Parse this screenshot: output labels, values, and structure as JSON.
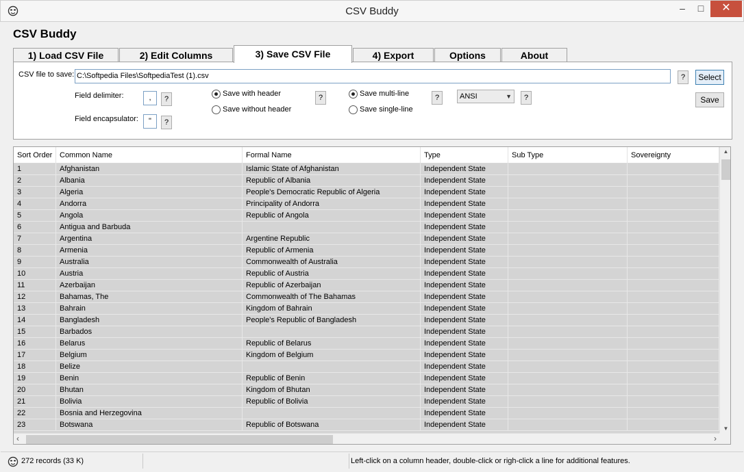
{
  "window": {
    "title": "CSV Buddy"
  },
  "app": {
    "heading": "CSV Buddy"
  },
  "tabs": [
    {
      "label": "1) Load CSV File"
    },
    {
      "label": "2) Edit Columns"
    },
    {
      "label": "3) Save CSV File"
    },
    {
      "label": "4) Export"
    },
    {
      "label": "Options"
    },
    {
      "label": "About"
    }
  ],
  "save": {
    "file_label": "CSV file to save:",
    "file_value": "C:\\Softpedia Files\\SoftpediaTest (1).csv",
    "help": "?",
    "select_label": "Select",
    "save_label": "Save",
    "delimiter_label": "Field delimiter:",
    "delimiter_value": ",",
    "encapsulator_label": "Field encapsulator:",
    "encapsulator_value": "\"",
    "header_with": "Save with header",
    "header_without": "Save without header",
    "multi_line": "Save multi-line",
    "single_line": "Save single-line",
    "encoding_value": "ANSI"
  },
  "grid": {
    "columns": [
      "Sort Order",
      "Common Name",
      "Formal Name",
      "Type",
      "Sub Type",
      "Sovereignty"
    ],
    "rows": [
      [
        "1",
        "Afghanistan",
        "Islamic State of Afghanistan",
        "Independent State",
        "",
        ""
      ],
      [
        "2",
        "Albania",
        "Republic of Albania",
        "Independent State",
        "",
        ""
      ],
      [
        "3",
        "Algeria",
        "People's Democratic Republic of Algeria",
        "Independent State",
        "",
        ""
      ],
      [
        "4",
        "Andorra",
        "Principality of Andorra",
        "Independent State",
        "",
        ""
      ],
      [
        "5",
        "Angola",
        "Republic of Angola",
        "Independent State",
        "",
        ""
      ],
      [
        "6",
        "Antigua and Barbuda",
        "",
        "Independent State",
        "",
        ""
      ],
      [
        "7",
        "Argentina",
        "Argentine Republic",
        "Independent State",
        "",
        ""
      ],
      [
        "8",
        "Armenia",
        "Republic of Armenia",
        "Independent State",
        "",
        ""
      ],
      [
        "9",
        "Australia",
        "Commonwealth of Australia",
        "Independent State",
        "",
        ""
      ],
      [
        "10",
        "Austria",
        "Republic of Austria",
        "Independent State",
        "",
        ""
      ],
      [
        "11",
        "Azerbaijan",
        "Republic of Azerbaijan",
        "Independent State",
        "",
        ""
      ],
      [
        "12",
        "Bahamas, The",
        "Commonwealth of The Bahamas",
        "Independent State",
        "",
        ""
      ],
      [
        "13",
        "Bahrain",
        "Kingdom of Bahrain",
        "Independent State",
        "",
        ""
      ],
      [
        "14",
        "Bangladesh",
        "People's Republic of Bangladesh",
        "Independent State",
        "",
        ""
      ],
      [
        "15",
        "Barbados",
        "",
        "Independent State",
        "",
        ""
      ],
      [
        "16",
        "Belarus",
        "Republic of Belarus",
        "Independent State",
        "",
        ""
      ],
      [
        "17",
        "Belgium",
        "Kingdom of Belgium",
        "Independent State",
        "",
        ""
      ],
      [
        "18",
        "Belize",
        "",
        "Independent State",
        "",
        ""
      ],
      [
        "19",
        "Benin",
        "Republic of Benin",
        "Independent State",
        "",
        ""
      ],
      [
        "20",
        "Bhutan",
        "Kingdom of Bhutan",
        "Independent State",
        "",
        ""
      ],
      [
        "21",
        "Bolivia",
        "Republic of Bolivia",
        "Independent State",
        "",
        ""
      ],
      [
        "22",
        "Bosnia and Herzegovina",
        "",
        "Independent State",
        "",
        ""
      ],
      [
        "23",
        "Botswana",
        "Republic of Botswana",
        "Independent State",
        "",
        ""
      ]
    ]
  },
  "status": {
    "records": "272 records (33 K)",
    "hint": "Left-click on a column header, double-click or righ-click a line for additional features."
  },
  "icons": {
    "app": "smiley-face-icon",
    "minimize": "minimize-icon",
    "maximize": "maximize-icon",
    "close": "close-icon"
  },
  "colors": {
    "close_button": "#c7503d",
    "grid_row": "#d4d4d4"
  }
}
